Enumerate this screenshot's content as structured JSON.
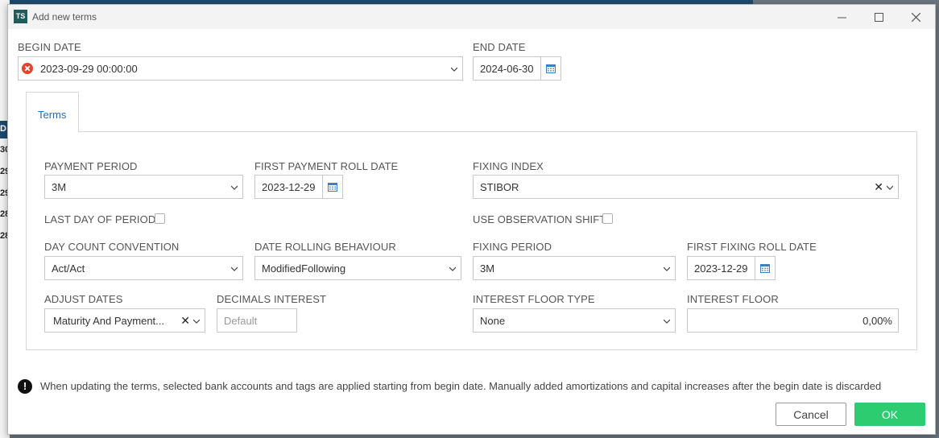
{
  "background": {
    "row_numbers": [
      "D",
      "30",
      "29",
      "29",
      "28",
      "28"
    ]
  },
  "dialog": {
    "app_icon": "TS",
    "title": "Add new terms"
  },
  "begin_date": {
    "label": "BEGIN DATE",
    "value": "2023-09-29 00:00:00"
  },
  "end_date": {
    "label": "END DATE",
    "value": "2024-06-30"
  },
  "tabs": [
    {
      "label": "Terms"
    }
  ],
  "terms": {
    "payment_period": {
      "label": "PAYMENT PERIOD",
      "value": "3M"
    },
    "first_payment_roll_date": {
      "label": "FIRST PAYMENT ROLL DATE",
      "value": "2023-12-29"
    },
    "fixing_index": {
      "label": "FIXING INDEX",
      "value": "STIBOR"
    },
    "last_day_of_period": {
      "label": "LAST DAY OF PERIOD",
      "checked": false
    },
    "use_observation_shift": {
      "label": "USE OBSERVATION SHIFT",
      "checked": false
    },
    "day_count_convention": {
      "label": "DAY COUNT CONVENTION",
      "value": "Act/Act"
    },
    "date_rolling_behaviour": {
      "label": "DATE ROLLING BEHAVIOUR",
      "value": "ModifiedFollowing"
    },
    "fixing_period": {
      "label": "FIXING PERIOD",
      "value": "3M"
    },
    "first_fixing_roll_date": {
      "label": "FIRST FIXING ROLL DATE",
      "value": "2023-12-29"
    },
    "adjust_dates": {
      "label": "ADJUST DATES",
      "value": "Maturity And Payment..."
    },
    "decimals_interest": {
      "label": "DECIMALS INTEREST",
      "placeholder": "Default"
    },
    "interest_floor_type": {
      "label": "INTEREST FLOOR TYPE",
      "value": "None"
    },
    "interest_floor": {
      "label": "INTEREST FLOOR",
      "value": "0,00%"
    }
  },
  "notice": "When updating the terms, selected bank accounts and tags are applied starting from begin date. Manually added amortizations and capital increases after the begin date is discarded",
  "buttons": {
    "cancel": "Cancel",
    "ok": "OK"
  },
  "colors": {
    "accent": "#2a6ca5",
    "ok_button": "#2ecc71",
    "error_icon": "#e2452d",
    "header_bg": "#1e4a6e"
  }
}
